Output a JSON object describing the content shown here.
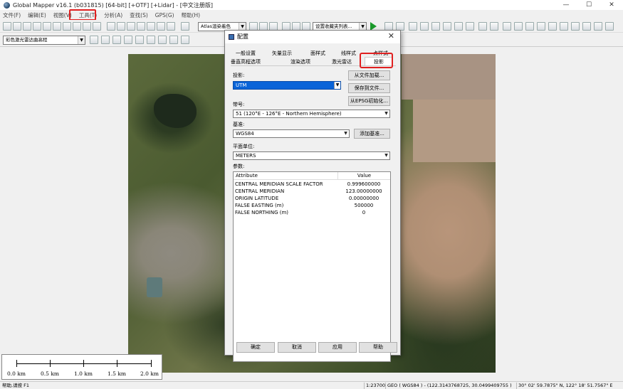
{
  "window": {
    "title": "Global Mapper v16.1 (b031815) [64-bit] [+OTF] [+Lidar] - [中文注册版]"
  },
  "menu": {
    "items": [
      "文件(F)",
      "编辑(E)",
      "视图(V)",
      "工具(T)",
      "分析(A)",
      "查找(S)",
      "GPS(G)",
      "帮助(H)"
    ]
  },
  "toolbar": {
    "render_combo": "Atlas渲染着色",
    "layer_combo": "设置收藏夹列表...",
    "elev_combo": "彩色激光雷达曲高程"
  },
  "dialog": {
    "title": "配置",
    "tabs_row1": [
      "一般设置",
      "矢量显示",
      "面样式",
      "线样式",
      "点样式"
    ],
    "tabs_row2": [
      "垂直高程选项",
      "渲染选项",
      "激光雷达"
    ],
    "active_tab": "投影",
    "projection_label": "投影:",
    "projection_value": "UTM",
    "load_from_file": "从文件加载...",
    "save_to_file": "保存到文件...",
    "init_from_epsg": "从EPSG初始化...",
    "zone_label": "带号:",
    "zone_value": "51 (120°E - 126°E - Northern Hemisphere)",
    "datum_label": "基准:",
    "datum_value": "WGS84",
    "add_datum": "添加基准...",
    "planar_units_label": "平面单位:",
    "planar_units_value": "METERS",
    "params_label": "参数:",
    "params_header": {
      "attribute": "Attribute",
      "value": "Value"
    },
    "params": [
      {
        "k": "CENTRAL MERIDIAN SCALE FACTOR",
        "v": "0.999600000"
      },
      {
        "k": "CENTRAL MERIDIAN",
        "v": "123.00000000"
      },
      {
        "k": "ORIGIN LATITUDE",
        "v": "0.00000000"
      },
      {
        "k": "FALSE EASTING (m)",
        "v": "500000"
      },
      {
        "k": "FALSE NORTHING (m)",
        "v": "0"
      }
    ],
    "ok": "确定",
    "cancel": "取消",
    "apply": "应用",
    "help": "帮助"
  },
  "scale_bar": {
    "labels": [
      "0.0 km",
      "0.5 km",
      "1.0 km",
      "1.5 km",
      "2.0 km"
    ]
  },
  "status": {
    "left": "帮助,请按 F1",
    "scale": "1:23700",
    "coords": "GEO ( WGS84 ) - (122.3143768725, 30.0499409755 )",
    "dms": "30° 02' 59.7875\" N, 122° 18' 51.7567\" E"
  },
  "colors": {
    "highlight": "#e02020",
    "selection": "#0a64d8"
  }
}
